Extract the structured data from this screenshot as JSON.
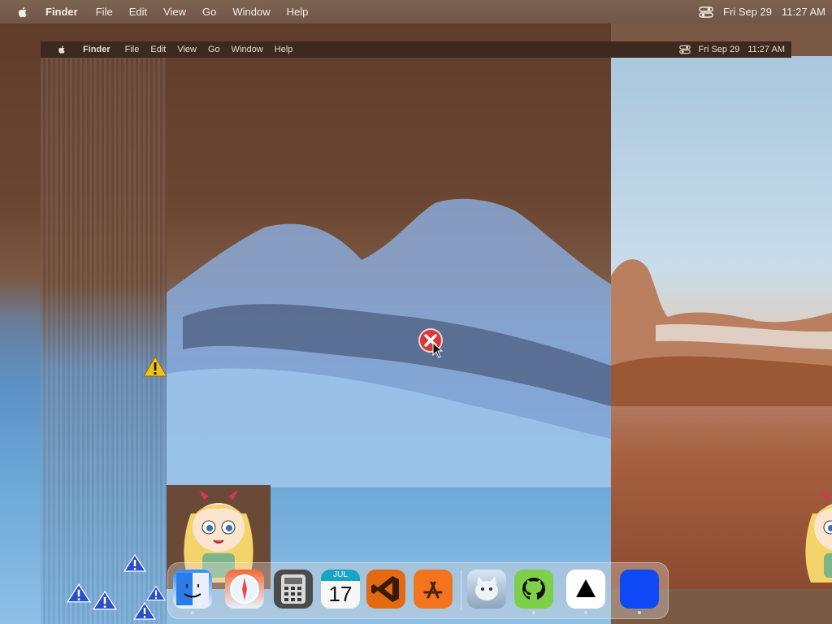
{
  "menubar": {
    "app_name": "Finder",
    "items": [
      "File",
      "Edit",
      "View",
      "Go",
      "Window",
      "Help"
    ],
    "date": "Fri Sep 29",
    "time": "11:27 AM"
  },
  "inner_menubar": {
    "app_name": "Finder",
    "items": [
      "File",
      "Edit",
      "View",
      "Go",
      "Window",
      "Help"
    ],
    "date": "Fri Sep 29",
    "time": "11:27 AM"
  },
  "dock": {
    "apps": [
      {
        "name": "Finder"
      },
      {
        "name": "Safari"
      },
      {
        "name": "Calculator"
      },
      {
        "name": "Calendar",
        "month": "JUL",
        "day": "17"
      },
      {
        "name": "Visual Studio Code"
      },
      {
        "name": "App Store"
      },
      {
        "name": "Photo"
      },
      {
        "name": "GitHub Desktop"
      },
      {
        "name": "Vectorworks"
      },
      {
        "name": "Blue App"
      }
    ]
  },
  "colors": {
    "menubar_bg": "#7d6352",
    "warning_yellow": "#f2c21b",
    "error_red": "#d43a3a"
  }
}
